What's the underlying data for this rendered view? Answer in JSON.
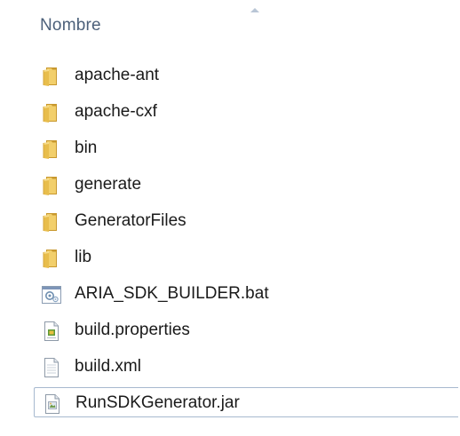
{
  "header": {
    "column_name": "Nombre"
  },
  "colors": {
    "header_text": "#4c607a",
    "folder_main": "#e8bd4c",
    "folder_light": "#f7dc8a",
    "folder_dark": "#c8982e",
    "selection_border": "#a7b9cf"
  },
  "files": [
    {
      "name": "apache-ant",
      "icon": "folder-icon"
    },
    {
      "name": "apache-cxf",
      "icon": "folder-icon"
    },
    {
      "name": "bin",
      "icon": "folder-icon"
    },
    {
      "name": "generate",
      "icon": "folder-icon"
    },
    {
      "name": "GeneratorFiles",
      "icon": "folder-icon"
    },
    {
      "name": "lib",
      "icon": "folder-icon"
    },
    {
      "name": "ARIA_SDK_BUILDER.bat",
      "icon": "batch-file-icon"
    },
    {
      "name": "build.properties",
      "icon": "properties-file-icon"
    },
    {
      "name": "build.xml",
      "icon": "text-file-icon"
    },
    {
      "name": "RunSDKGenerator.jar",
      "icon": "jar-file-icon",
      "selected": true
    }
  ]
}
